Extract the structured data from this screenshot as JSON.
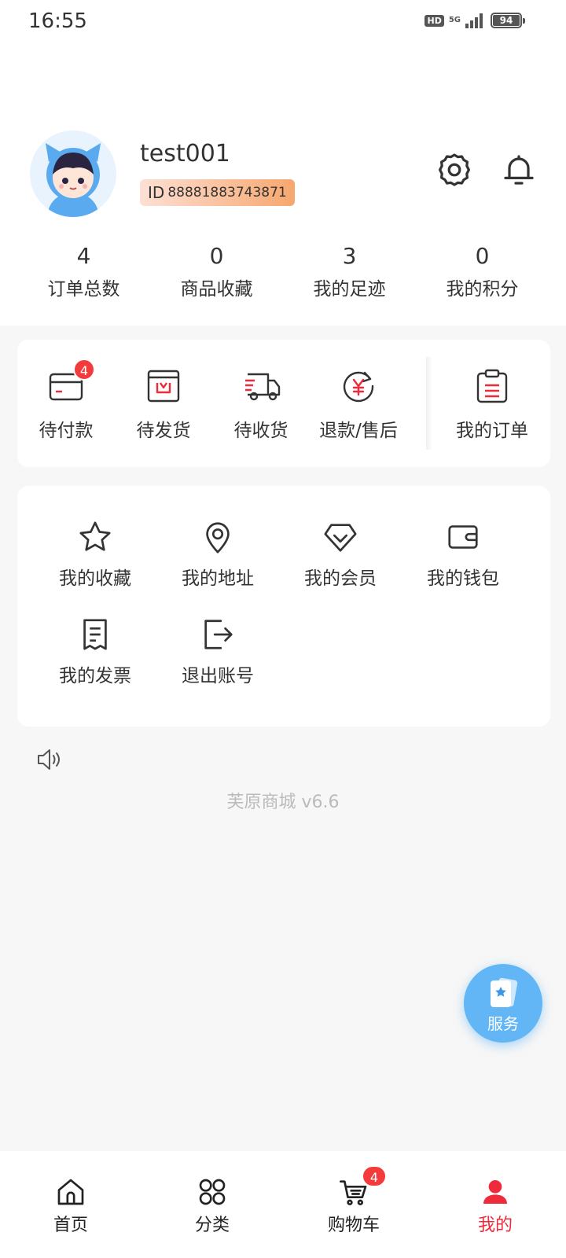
{
  "status_bar": {
    "time": "16:55",
    "network_badge": "HD",
    "network_type": "5G",
    "battery": "94",
    "battery_level": 0.94
  },
  "profile": {
    "username": "test001",
    "id_label": "ID",
    "id_value": "88881883743871",
    "avatar_icon": "avatar-cat-hood-icon"
  },
  "header_icons": {
    "settings": "gear-icon",
    "notifications": "bell-icon"
  },
  "stats": [
    {
      "value": "4",
      "label": "订单总数"
    },
    {
      "value": "0",
      "label": "商品收藏"
    },
    {
      "value": "3",
      "label": "我的足迹"
    },
    {
      "value": "0",
      "label": "我的积分"
    }
  ],
  "orders": {
    "items": [
      {
        "label": "待付款",
        "badge": "4",
        "icon": "wallet-card-icon"
      },
      {
        "label": "待发货",
        "badge": "",
        "icon": "package-box-icon"
      },
      {
        "label": "待收货",
        "badge": "",
        "icon": "delivery-truck-icon"
      },
      {
        "label": "退款/售后",
        "badge": "",
        "icon": "refund-yen-icon"
      }
    ],
    "all_orders": {
      "label": "我的订单",
      "icon": "clipboard-icon"
    }
  },
  "tools": [
    {
      "label": "我的收藏",
      "icon": "star-icon"
    },
    {
      "label": "我的地址",
      "icon": "location-pin-icon"
    },
    {
      "label": "我的会员",
      "icon": "diamond-icon"
    },
    {
      "label": "我的钱包",
      "icon": "wallet-icon"
    },
    {
      "label": "我的发票",
      "icon": "receipt-icon"
    },
    {
      "label": "退出账号",
      "icon": "logout-icon"
    }
  ],
  "version_text": "芙原商城 v6.6",
  "service": {
    "label": "服务",
    "icon": "service-card-star-icon"
  },
  "tabbar": {
    "items": [
      {
        "label": "首页",
        "icon": "home-icon",
        "badge": ""
      },
      {
        "label": "分类",
        "icon": "grid-icon",
        "badge": ""
      },
      {
        "label": "购物车",
        "icon": "cart-icon",
        "badge": "4"
      },
      {
        "label": "我的",
        "icon": "user-icon",
        "badge": ""
      }
    ],
    "active_index": 3
  },
  "colors": {
    "accent": "#f33b3b",
    "active_tab": "#ef2a3a",
    "service_fab": "#63b6f5",
    "id_badge_from": "#fde0d4",
    "id_badge_to": "#f7a76e"
  }
}
